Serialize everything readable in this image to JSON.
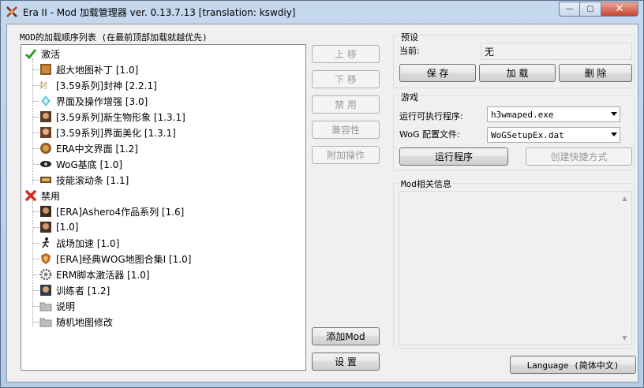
{
  "window": {
    "title": "Era II - Mod 加载管理器 ver. 0.13.7.13 [translation: kswdiy]",
    "controls": {
      "minimize": "—",
      "maximize": "▢",
      "close": "✕"
    }
  },
  "mod_list": {
    "label": "MOD的加载顺序列表 (在最前顶部加载就越优先)",
    "active_header": "激活",
    "active_items": [
      "超大地图补丁 [1.0]",
      "[3.59系列]封神 [2.2.1]",
      "界面及操作增强 [3.0]",
      "[3.59系列]新生物形象 [1.3.1]",
      "[3.59系列]界面美化 [1.3.1]",
      "ERA中文界面 [1.2]",
      "WoG基底 [1.0]",
      "技能滚动条 [1.1]"
    ],
    "disabled_header": "禁用",
    "disabled_items": [
      "[ERA]Ashero4作品系列 [1.6]",
      "[1.0]",
      "战场加速 [1.0]",
      "[ERA]经典WOG地图合集Ⅰ [1.0]",
      "ERM脚本激活器 [1.0]",
      "训练者 [1.2]",
      "说明",
      "随机地图修改"
    ]
  },
  "mod_buttons": {
    "move_up": "上 移",
    "move_down": "下 移",
    "disable": "禁 用",
    "compat": "兼容性",
    "extra": "附加操作",
    "add_mod": "添加Mod",
    "settings": "设 置"
  },
  "preset": {
    "label": "预设",
    "current_label": "当前:",
    "current_value": "无",
    "save": "保 存",
    "load": "加 载",
    "delete": "删 除"
  },
  "game": {
    "label": "游戏",
    "exe_label": "运行可执行程序:",
    "exe_value": "h3wmaped.exe",
    "cfg_label": "WoG 配置文件:",
    "cfg_value": "WoGSetupEx.dat",
    "run": "运行程序",
    "shortcut": "创建快捷方式"
  },
  "info": {
    "label": "Mod相关信息"
  },
  "language_button": "Language (简体中文)",
  "icons": {
    "app": "era-crossed-swords-icon",
    "active": "green-check-icon",
    "disabled": "red-x-icon",
    "folder": "folder-icon"
  },
  "colors": {
    "accent_check": "#2e9b2e",
    "accent_x": "#d42a1e",
    "window_frame": "#b4cbe6"
  }
}
